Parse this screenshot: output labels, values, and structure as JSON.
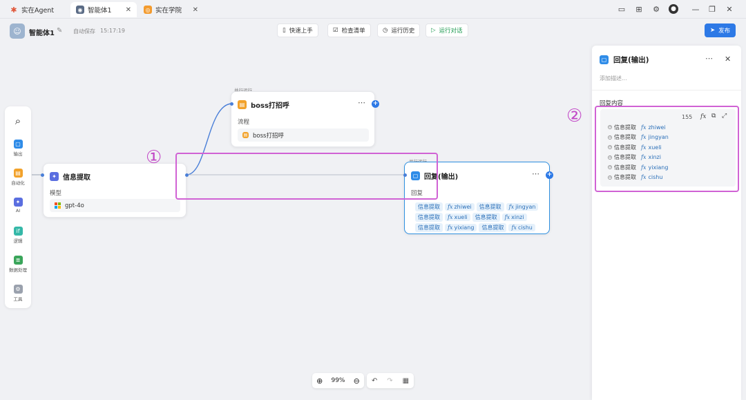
{
  "tabs": [
    {
      "label": "实在Agent",
      "icon": "agent-logo-icon"
    },
    {
      "label": "智能体1",
      "icon": "agent-tab-icon",
      "close": "✕"
    },
    {
      "label": "实在学院",
      "icon": "academy-icon",
      "close": "✕"
    }
  ],
  "header": {
    "agent_name": "智能体1",
    "autosave_label": "自动保存",
    "autosave_time": "15:17:19",
    "publish_label": "发布"
  },
  "toolbar": {
    "quickstart": "快速上手",
    "checklist": "检查清单",
    "history": "运行历史",
    "run": "运行对话"
  },
  "sidebar": {
    "items": [
      "输出",
      "自动化",
      "AI",
      "逻辑",
      "数据处理",
      "工具"
    ]
  },
  "nodes": {
    "extract": {
      "title": "信息提取",
      "model_label": "模型",
      "model_value": "gpt-4o"
    },
    "boss": {
      "parallel": "并行运行",
      "title": "boss打招呼",
      "flow_label": "流程",
      "flow_value": "boss打招呼"
    },
    "reply": {
      "parallel": "并行运行",
      "title": "回复(输出)",
      "reply_label": "回复",
      "tags": [
        [
          {
            "src": "信息提取",
            "var": "zhiwei"
          },
          {
            "src": "信息提取",
            "var": "jingyan"
          }
        ],
        [
          {
            "src": "信息提取",
            "var": "xueli"
          },
          {
            "src": "信息提取",
            "var": "xinzi"
          }
        ],
        [
          {
            "src": "信息提取",
            "var": "yixiang"
          },
          {
            "src": "信息提取",
            "var": "cishu"
          }
        ]
      ]
    }
  },
  "panel": {
    "title": "回复(输出)",
    "description_placeholder": "添加描述...",
    "content_label": "回复内容",
    "char_count": "155",
    "fx": "fx",
    "rows": [
      {
        "src": "信息提取",
        "var": "zhiwei"
      },
      {
        "src": "信息提取",
        "var": "jingyan"
      },
      {
        "src": "信息提取",
        "var": "xueli"
      },
      {
        "src": "信息提取",
        "var": "xinzi"
      },
      {
        "src": "信息提取",
        "var": "yixiang"
      },
      {
        "src": "信息提取",
        "var": "cishu"
      }
    ]
  },
  "annotations": {
    "one": "①",
    "two": "②"
  },
  "zoom": {
    "level": "99%"
  },
  "colors": {
    "accent": "#2d79e6",
    "highlight": "#d062d4",
    "tag_bg": "#e6f1fb"
  }
}
